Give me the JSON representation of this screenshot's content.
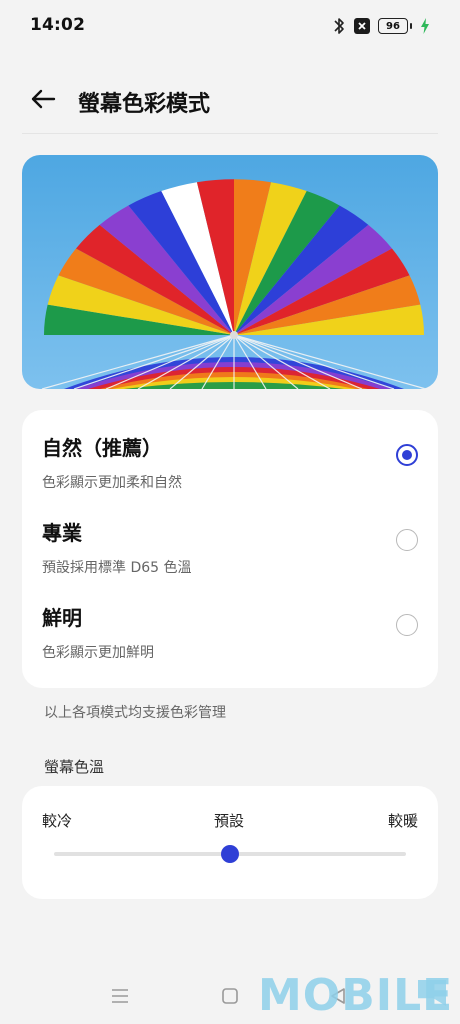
{
  "status_bar": {
    "time": "14:02",
    "icons": [
      "bluetooth-icon",
      "close-box-icon",
      "battery-icon",
      "charging-bolt-icon"
    ],
    "battery_level": "96"
  },
  "header": {
    "back_icon": "arrow-left-icon",
    "title": "螢幕色彩模式"
  },
  "preview": {
    "image": "rainbow-parachute-photo"
  },
  "color_modes": {
    "selected_index": 0,
    "options": [
      {
        "title": "自然（推薦）",
        "description": "色彩顯示更加柔和自然"
      },
      {
        "title": "專業",
        "description": "預設採用標準 D65 色溫"
      },
      {
        "title": "鮮明",
        "description": "色彩顯示更加鮮明"
      }
    ]
  },
  "note": "以上各項模式均支援色彩管理",
  "temperature": {
    "section_label": "螢幕色溫",
    "labels": {
      "cool": "較冷",
      "default": "預設",
      "warm": "較暖"
    },
    "value_fraction": 0.5
  },
  "nav_bar": {
    "icons": [
      "menu-icon",
      "home-square-icon",
      "back-triangle-icon"
    ]
  },
  "watermark": "MOBILE",
  "colors": {
    "accent": "#2f3fd6",
    "background": "#f3f3f3",
    "card": "#ffffff",
    "watermark": "#8fd0ea"
  }
}
